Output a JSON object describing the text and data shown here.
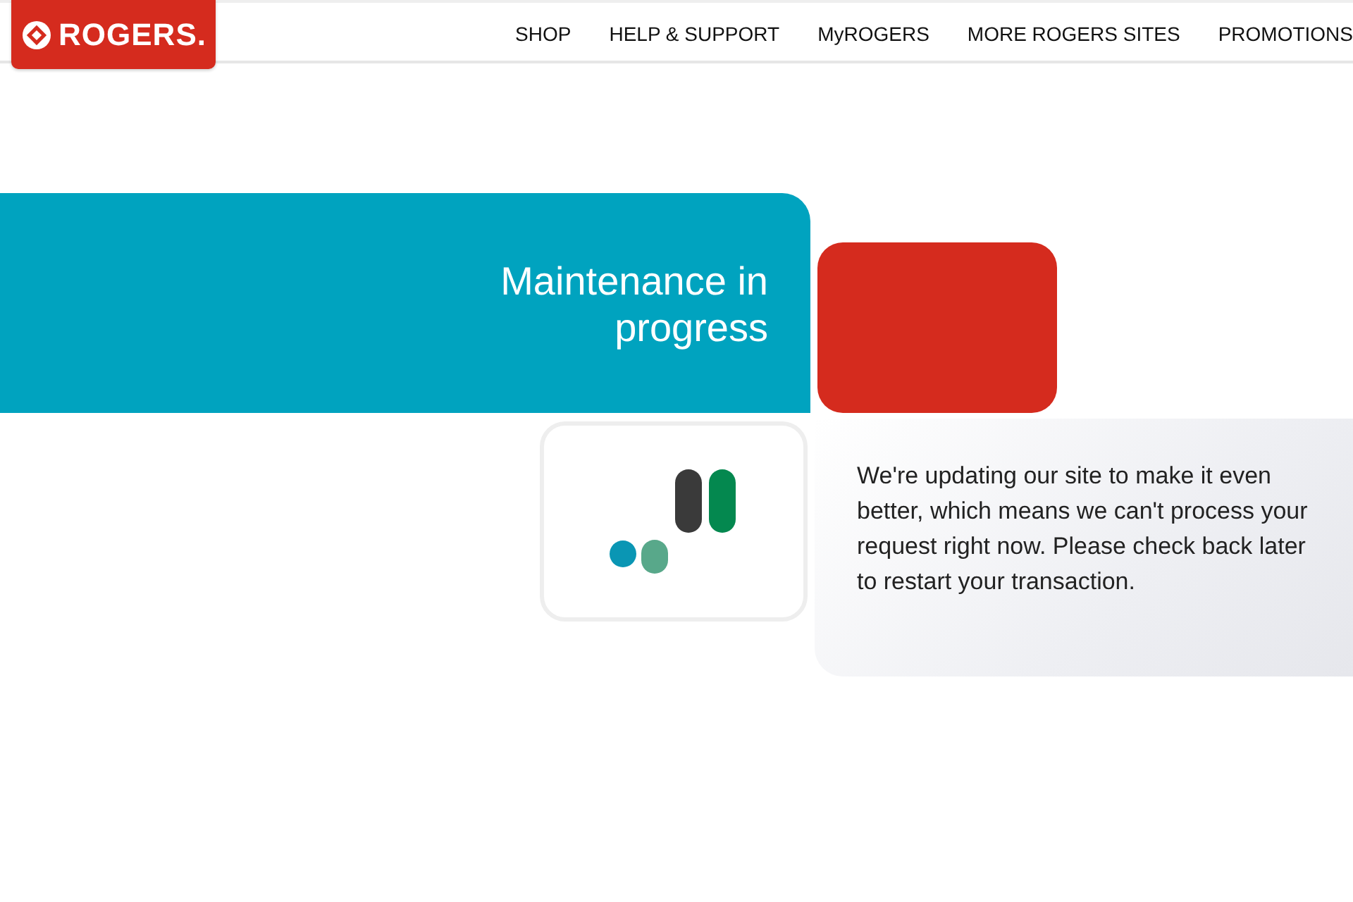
{
  "header": {
    "logo": "ROGERS.",
    "nav": [
      {
        "label": "SHOP"
      },
      {
        "label": "HELP & SUPPORT"
      },
      {
        "label": "MyROGERS"
      },
      {
        "label": "MORE ROGERS SITES"
      },
      {
        "label": "PROMOTIONS"
      }
    ]
  },
  "banner": {
    "title": "Maintenance in progress"
  },
  "message": {
    "text": "We're updating our site to make it even better, which means we can't process your request right now. Please check back later to restart your transaction."
  }
}
